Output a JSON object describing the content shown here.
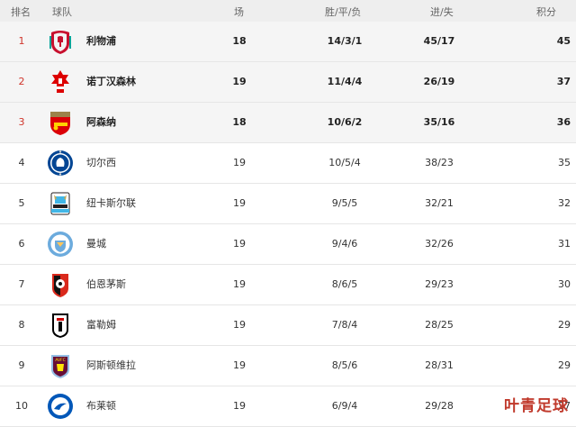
{
  "header": {
    "rank": "排名",
    "team": "球队",
    "played": "场",
    "wdl": "胜/平/负",
    "goals": "进/失",
    "points": "积分"
  },
  "rows": [
    {
      "rank": "1",
      "team": "利物浦",
      "played": "18",
      "wdl": "14/3/1",
      "goals": "45/17",
      "points": "45",
      "logo": "liverpool-crest-icon"
    },
    {
      "rank": "2",
      "team": "诺丁汉森林",
      "played": "19",
      "wdl": "11/4/4",
      "goals": "26/19",
      "points": "37",
      "logo": "nottingham-forest-crest-icon"
    },
    {
      "rank": "3",
      "team": "阿森纳",
      "played": "18",
      "wdl": "10/6/2",
      "goals": "35/16",
      "points": "36",
      "logo": "arsenal-crest-icon"
    },
    {
      "rank": "4",
      "team": "切尔西",
      "played": "19",
      "wdl": "10/5/4",
      "goals": "38/23",
      "points": "35",
      "logo": "chelsea-crest-icon"
    },
    {
      "rank": "5",
      "team": "纽卡斯尔联",
      "played": "19",
      "wdl": "9/5/5",
      "goals": "32/21",
      "points": "32",
      "logo": "newcastle-crest-icon"
    },
    {
      "rank": "6",
      "team": "曼城",
      "played": "19",
      "wdl": "9/4/6",
      "goals": "32/26",
      "points": "31",
      "logo": "man-city-crest-icon"
    },
    {
      "rank": "7",
      "team": "伯恩茅斯",
      "played": "19",
      "wdl": "8/6/5",
      "goals": "29/23",
      "points": "30",
      "logo": "bournemouth-crest-icon"
    },
    {
      "rank": "8",
      "team": "富勒姆",
      "played": "19",
      "wdl": "7/8/4",
      "goals": "28/25",
      "points": "29",
      "logo": "fulham-crest-icon"
    },
    {
      "rank": "9",
      "team": "阿斯顿维拉",
      "played": "19",
      "wdl": "8/5/6",
      "goals": "28/31",
      "points": "29",
      "logo": "aston-villa-crest-icon"
    },
    {
      "rank": "10",
      "team": "布莱顿",
      "played": "19",
      "wdl": "6/9/4",
      "goals": "29/28",
      "points": "27",
      "logo": "brighton-crest-icon"
    }
  ],
  "crest_text": {
    "aston_villa": "AVFC"
  },
  "colors": {
    "top_rank_red": "#d0352b",
    "header_bg": "#eeeeee",
    "top_row_bg": "#f5f5f5",
    "watermark_red": "#c0392b"
  },
  "watermark": "叶青足球"
}
